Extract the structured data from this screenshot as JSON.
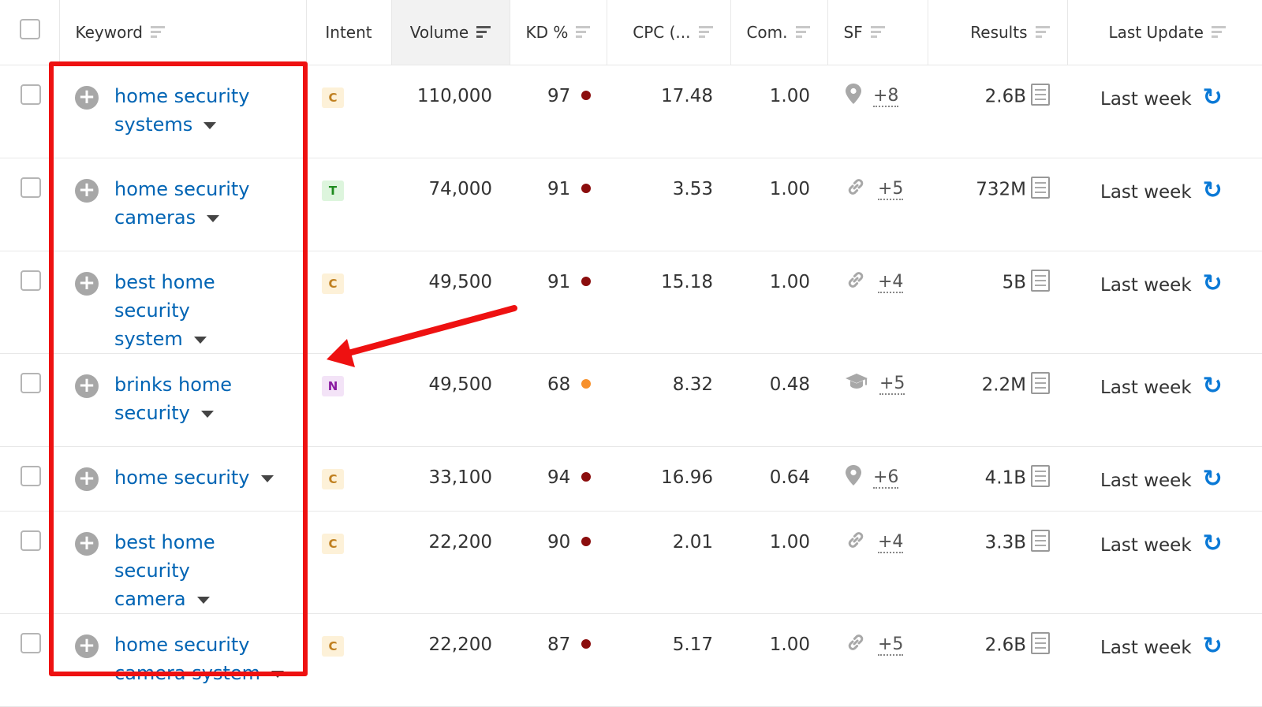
{
  "header": {
    "keyword": "Keyword",
    "intent": "Intent",
    "volume": "Volume",
    "kd": "KD %",
    "cpc": "CPC (...",
    "com": "Com.",
    "sf": "SF",
    "results": "Results",
    "last_update": "Last Update"
  },
  "colors": {
    "link": "#0064b4",
    "highlight_box": "#ee1111",
    "kd_high": "#8b0d0d",
    "kd_mid": "#f7902b",
    "intent_c_bg": "#fdf1d8",
    "intent_c_fg": "#c08020",
    "intent_t_bg": "#ddf5dd",
    "intent_t_fg": "#1e8b1e",
    "intent_n_bg": "#f3e3f7",
    "intent_n_fg": "#8a1aa0",
    "refresh": "#0a79d6"
  },
  "rows": [
    {
      "l1": "home security",
      "l2": "systems",
      "intent": "C",
      "volume": "110,000",
      "kd": "97",
      "kd_level": "high",
      "cpc": "17.48",
      "com": "1.00",
      "sf_icon": "location-pin-icon",
      "sf_more": "+8",
      "results": "2.6B",
      "updated": "Last week"
    },
    {
      "l1": "home security",
      "l2": "cameras",
      "intent": "T",
      "volume": "74,000",
      "kd": "91",
      "kd_level": "high",
      "cpc": "3.53",
      "com": "1.00",
      "sf_icon": "link-icon",
      "sf_more": "+5",
      "results": "732M",
      "updated": "Last week"
    },
    {
      "l1": "best home security",
      "l2": "system",
      "intent": "C",
      "volume": "49,500",
      "kd": "91",
      "kd_level": "high",
      "cpc": "15.18",
      "com": "1.00",
      "sf_icon": "link-icon",
      "sf_more": "+4",
      "results": "5B",
      "updated": "Last week"
    },
    {
      "l1": "brinks home",
      "l2": "security",
      "intent": "N",
      "volume": "49,500",
      "kd": "68",
      "kd_level": "mid",
      "cpc": "8.32",
      "com": "0.48",
      "sf_icon": "graduation-cap-icon",
      "sf_more": "+5",
      "results": "2.2M",
      "updated": "Last week"
    },
    {
      "l1": "home security",
      "l2": "",
      "intent": "C",
      "volume": "33,100",
      "kd": "94",
      "kd_level": "high",
      "cpc": "16.96",
      "com": "0.64",
      "sf_icon": "location-pin-icon",
      "sf_more": "+6",
      "results": "4.1B",
      "updated": "Last week"
    },
    {
      "l1": "best home security",
      "l2": "camera",
      "intent": "C",
      "volume": "22,200",
      "kd": "90",
      "kd_level": "high",
      "cpc": "2.01",
      "com": "1.00",
      "sf_icon": "link-icon",
      "sf_more": "+4",
      "results": "3.3B",
      "updated": "Last week"
    },
    {
      "l1": "home security",
      "l2": "camera system",
      "intent": "C",
      "volume": "22,200",
      "kd": "87",
      "kd_level": "high",
      "cpc": "5.17",
      "com": "1.00",
      "sf_icon": "link-icon",
      "sf_more": "+5",
      "results": "2.6B",
      "updated": "Last week"
    }
  ]
}
